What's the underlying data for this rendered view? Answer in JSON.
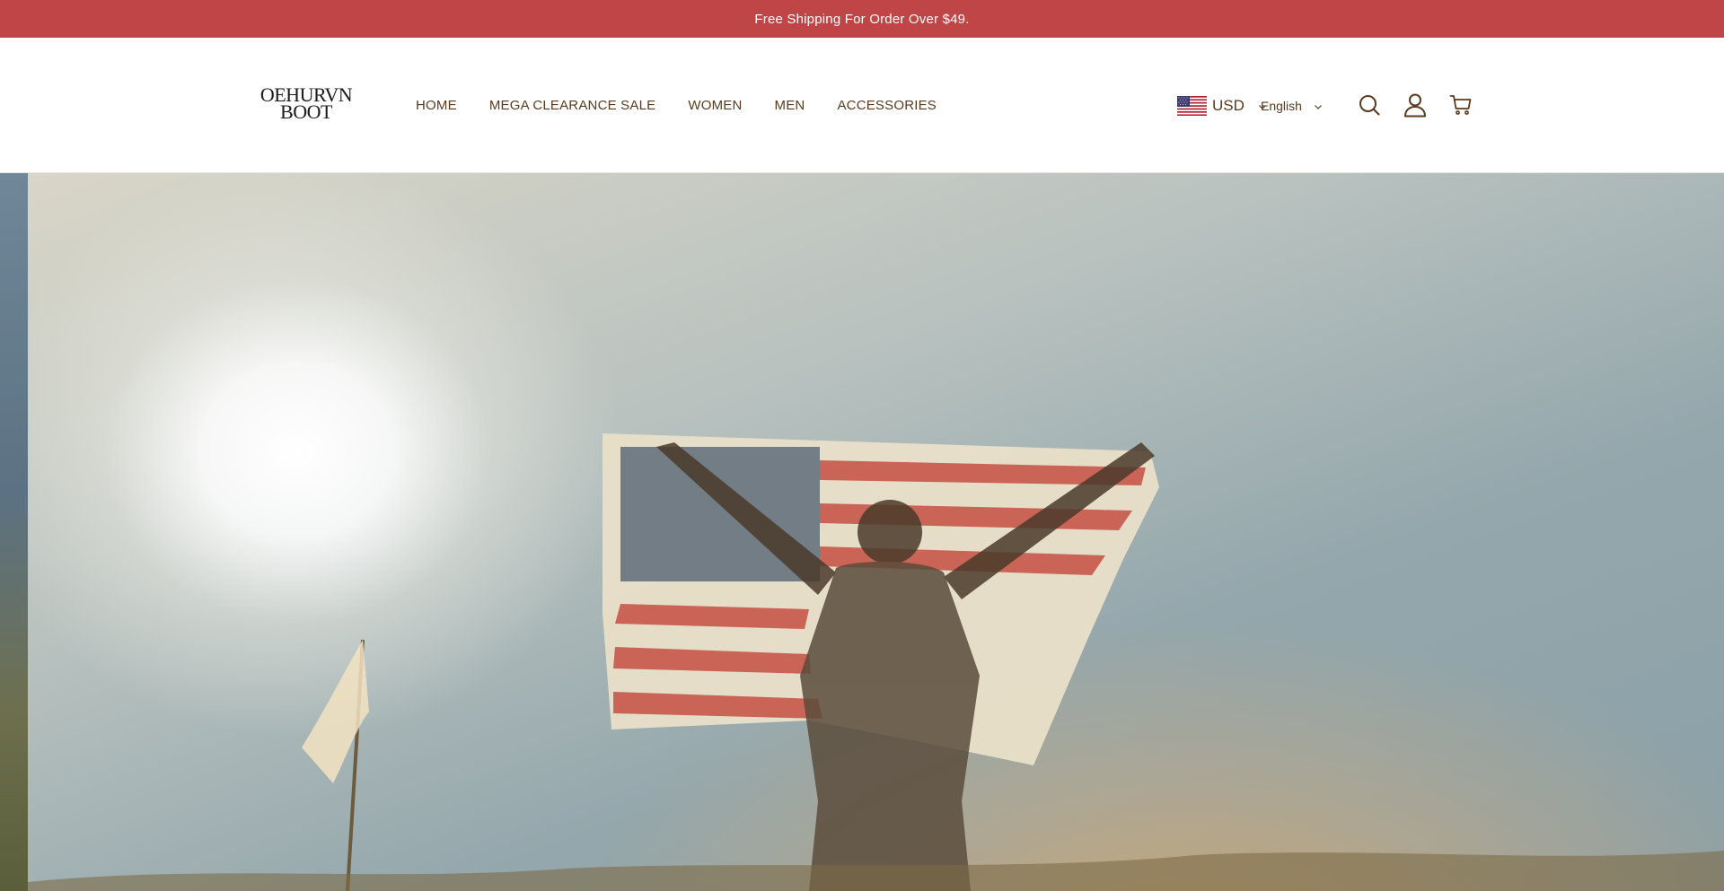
{
  "announcement": {
    "text": "Free Shipping For Order Over $49."
  },
  "logo": {
    "line1": "OEHURVN",
    "line2": "BOOT"
  },
  "nav": {
    "items": [
      {
        "label": "HOME"
      },
      {
        "label": "MEGA CLEARANCE SALE"
      },
      {
        "label": "WOMEN"
      },
      {
        "label": "MEN"
      },
      {
        "label": "ACCESSORIES"
      }
    ]
  },
  "currency": {
    "code": "USD",
    "flag_icon": "us-flag-icon"
  },
  "language": {
    "label": "English"
  },
  "icons": {
    "search": "search-icon",
    "account": "account-icon",
    "cart": "cart-icon"
  },
  "colors": {
    "announcement_bg": "#bf4546",
    "nav_text": "#5a3a1e",
    "header_bg": "#ffffff"
  }
}
